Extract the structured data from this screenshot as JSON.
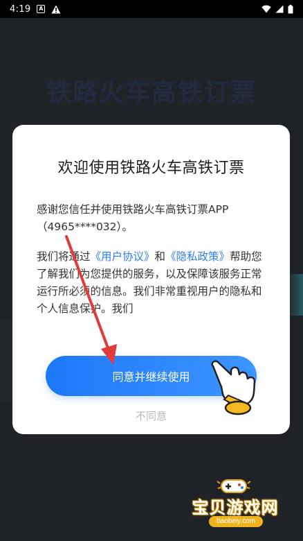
{
  "status_bar": {
    "time": "4:19",
    "left_icons": [
      "notification-a-icon",
      "warning-icon"
    ],
    "right_icons": [
      "wifi-icon",
      "cellular-icon",
      "battery-icon"
    ]
  },
  "background": {
    "title": "铁路火车高铁订票"
  },
  "dialog": {
    "title": "欢迎使用铁路火车高铁订票",
    "paragraph1": "感谢您信任并使用铁路火车高铁订票APP（4965****032）。",
    "paragraph2_prefix": "我们将通过",
    "user_agreement_link": "《用户协议》",
    "and_text": "和",
    "privacy_link": "《隐私政策》",
    "paragraph2_suffix": "帮助您了解我们为您提供的服务，以及保障该服务正常运行所必须的信息。我们非常重视用户的隐私和个人信息保护。我们",
    "agree_button": "同意并继续使用",
    "disagree_button": "不同意"
  },
  "watermark": {
    "text": "宝贝游戏网",
    "url": "baobeiy.com"
  },
  "colors": {
    "accent": "#2d7ff2",
    "button": "#1d78f7",
    "annotation_arrow": "#e03a3a"
  }
}
